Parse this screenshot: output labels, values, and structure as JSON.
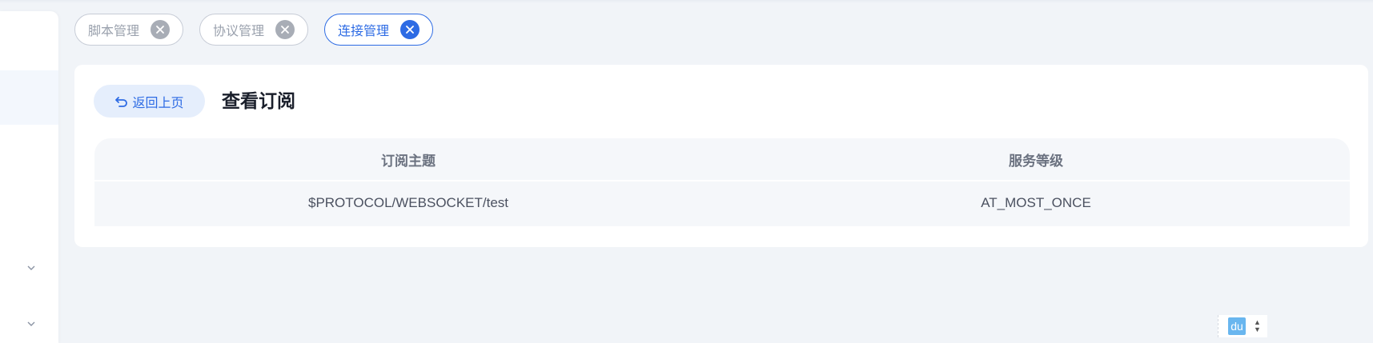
{
  "tabs": [
    {
      "label": "脚本管理",
      "active": false
    },
    {
      "label": "协议管理",
      "active": false
    },
    {
      "label": "连接管理",
      "active": true
    }
  ],
  "page": {
    "back_label": "返回上页",
    "title": "查看订阅"
  },
  "table": {
    "columns": [
      "订阅主题",
      "服务等级"
    ],
    "rows": [
      [
        "$PROTOCOL/WEBSOCKET/test",
        "AT_MOST_ONCE"
      ]
    ]
  },
  "widget": {
    "label": "du"
  },
  "icons": {
    "tab_close": "close-circle-icon",
    "back": "return-arrow-icon",
    "sidebar_expand": "chevron-down-icon"
  },
  "colors": {
    "accent": "#2d6be4",
    "background": "#f1f4f8",
    "card": "#ffffff"
  }
}
